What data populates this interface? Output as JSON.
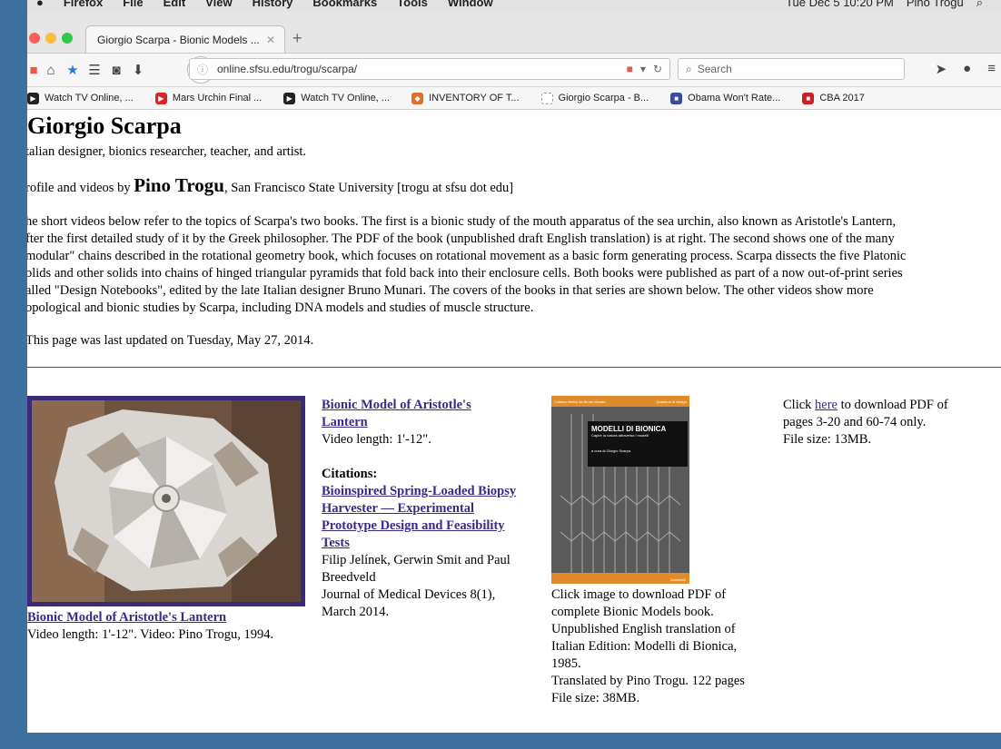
{
  "menubar": {
    "items": [
      "Firefox",
      "File",
      "Edit",
      "View",
      "History",
      "Bookmarks",
      "Tools",
      "Window"
    ],
    "clock": "Tue Dec 5 10:20 PM",
    "user": "Pino Trogu"
  },
  "tab": {
    "title": "Giorgio Scarpa - Bionic Models ...",
    "close": "✕",
    "new": "+"
  },
  "toolbar": {
    "url": "online.sfsu.edu/trogu/scarpa/",
    "search_placeholder": "Search"
  },
  "bookmarks": [
    {
      "label": "Watch TV Online, ...",
      "color": "#222222",
      "glyph": "▶"
    },
    {
      "label": "Mars Urchin Final ...",
      "color": "#d6262b",
      "glyph": "▶"
    },
    {
      "label": "Watch TV Online, ...",
      "color": "#222222",
      "glyph": "▶"
    },
    {
      "label": "INVENTORY OF T...",
      "color": "#e36b2c",
      "glyph": "◆"
    },
    {
      "label": "Giorgio Scarpa - B...",
      "color": "#999999",
      "glyph": ""
    },
    {
      "label": "Obama Won't Rate...",
      "color": "#3a4aa0",
      "glyph": "■"
    },
    {
      "label": "CBA 2017",
      "color": "#cc1f1f",
      "glyph": "■"
    }
  ],
  "page": {
    "title": "Giorgio Scarpa",
    "subtitle": "talian designer, bionics researcher, teacher, and artist.",
    "profile_prefix": "rofile and videos by ",
    "profile_name": "Pino Trogu",
    "profile_suffix": ", San Francisco State University [trogu at sfsu dot edu]",
    "intro_lines": [
      "he short videos below refer to the topics of Scarpa's two books. The first is a bionic study of the mouth apparatus of the sea urchin, also known as Aristotle's Lantern,",
      "fter the first detailed study of it by the Greek philosopher. The PDF of the book (unpublished draft English translation) is at right. The second shows one of the many",
      "modular\" chains described in the rotational geometry book, which focuses on rotational movement as a basic form generating process. Scarpa dissects the five Platonic",
      "olids and other solids into chains of hinged triangular pyramids that fold back into their enclosure cells. Both books were published as part of a now out-of-print series",
      "alled \"Design Notebooks\", edited by the late Italian designer Bruno Munari. The covers of the books in that series are shown below. The other videos show more",
      "opological and bionic studies by Scarpa, including DNA models and studies of muscle structure."
    ],
    "updated": "This page was last updated on Tuesday, May 27, 2014."
  },
  "col1": {
    "link": "Bionic Model of Aristotle's Lantern",
    "caption": "Video length: 1'-12\". Video: Pino Trogu, 1994."
  },
  "col2": {
    "link_line1": "Bionic Model of Aristotle's",
    "link_line2": "Lantern",
    "length": "Video length: 1'-12\".",
    "citations_label": "Citations:",
    "cite_lines": [
      "Bioinspired Spring-Loaded Biopsy",
      "Harvester — Experimental",
      "Prototype Design and Feasibility",
      "Tests"
    ],
    "authors_lines": [
      "Filip Jelínek, Gerwin Smit and Paul",
      "Breedveld",
      "Journal of Medical Devices 8(1),",
      "March 2014."
    ]
  },
  "col3": {
    "cover_series": "Collana diretta da Bruno Munari",
    "cover_label": "Quaderni di design",
    "cover_title": "MODELLI DI BIONICA",
    "cover_sub": "Capire la natura attraverso i modelli",
    "cover_author": "a cura di Giorgio Scarpa",
    "cover_publisher": "Zanichelli",
    "lines": [
      "Click image to download PDF of",
      "complete Bionic Models book.",
      "Unpublished English translation of",
      "Italian Edition: Modelli di Bionica,",
      "1985.",
      "Translated by Pino Trogu. 122 pages",
      "File size: 38MB."
    ]
  },
  "col4": {
    "prefix": "Click ",
    "link": "here",
    "suffix": " to download PDF of",
    "line2": "pages 3-20 and 60-74 only.",
    "line3": "File size: 13MB."
  }
}
